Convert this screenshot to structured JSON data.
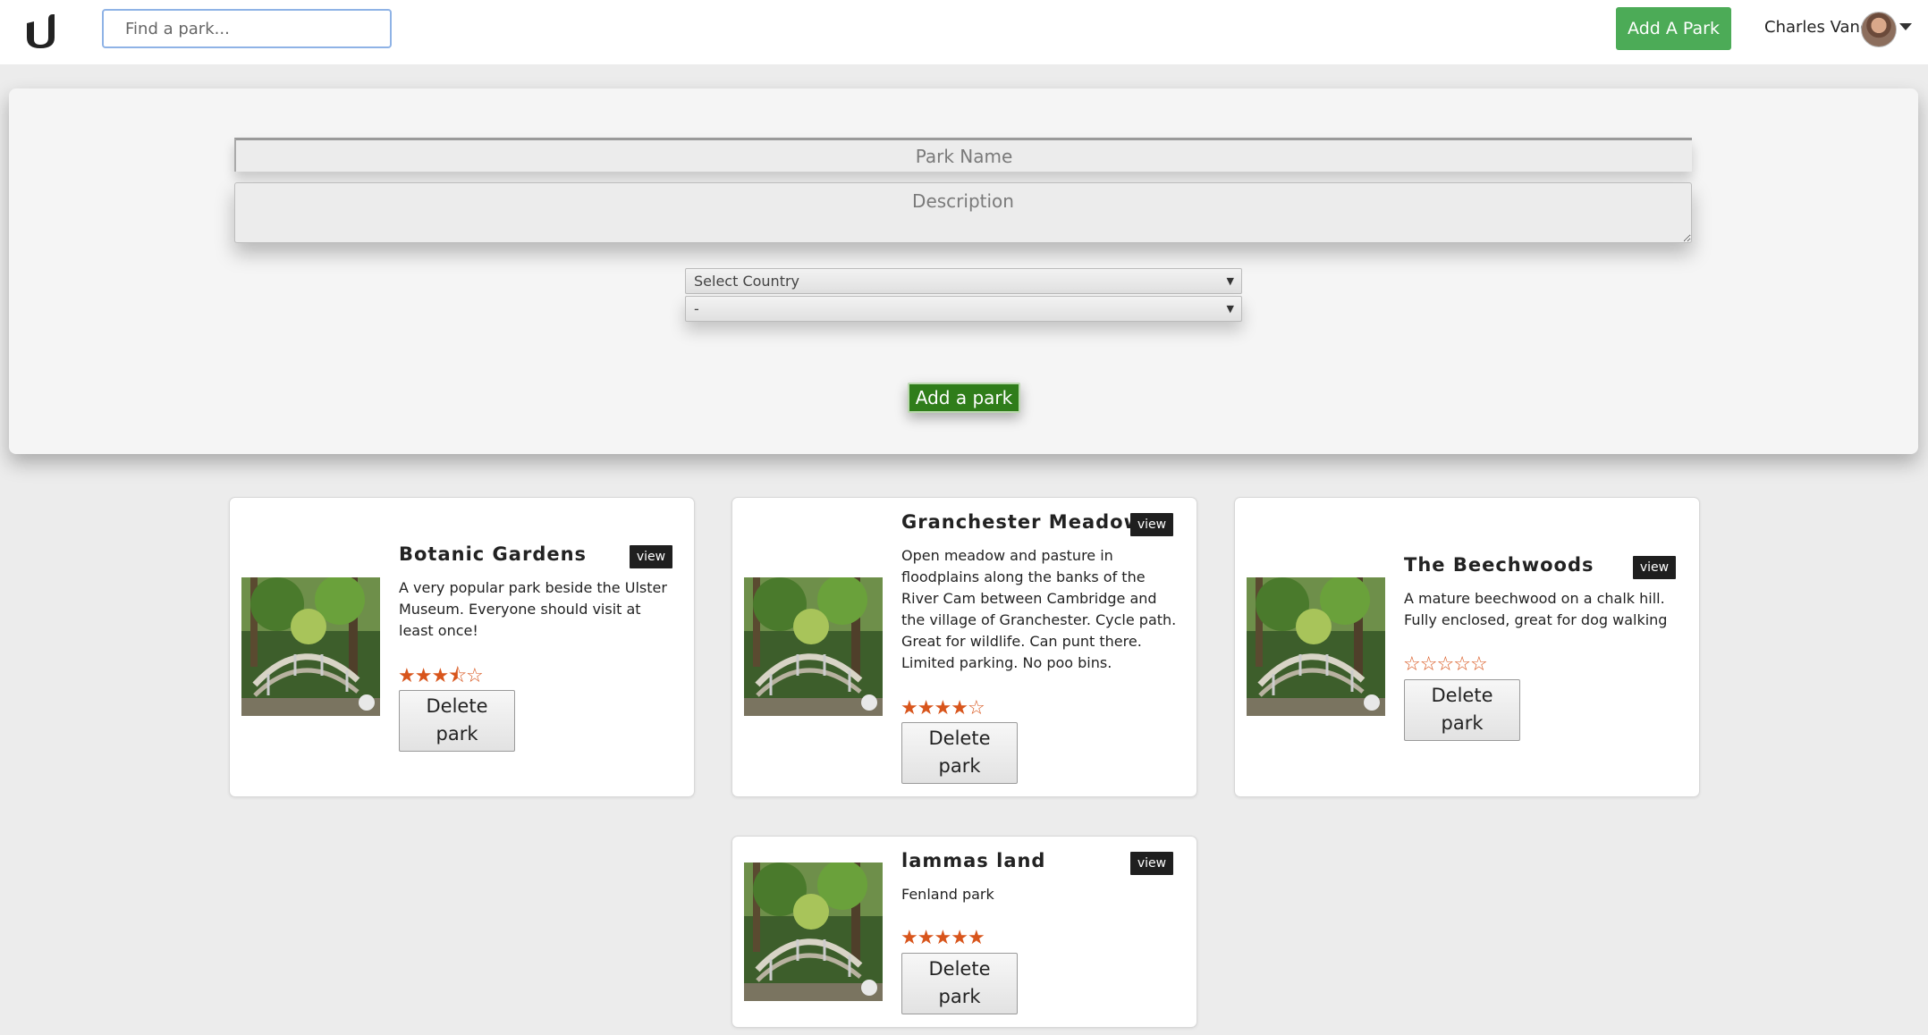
{
  "header": {
    "search_placeholder": "Find a park...",
    "add_park_label": "Add A Park",
    "user_name": "Charles Vane"
  },
  "form": {
    "name_placeholder": "Park Name",
    "description_placeholder": "Description",
    "country_select": "Select Country",
    "region_select": "-",
    "submit_label": "Add a park"
  },
  "parks": [
    {
      "name": "Botanic Gardens",
      "view_label": "view",
      "description": "A very popular park beside the Ulster Museum. Everyone should visit at least once!",
      "rating": 3.5,
      "delete_line1": "Delete",
      "delete_line2": "park"
    },
    {
      "name": "Granchester Meadows",
      "view_label": "view",
      "description": "Open meadow and pasture in floodplains along the banks of the River Cam between Cambridge and the village of Granchester. Cycle path. Great for wildlife. Can punt there. Limited parking. No poo bins.",
      "rating": 4,
      "delete_line1": "Delete",
      "delete_line2": "park"
    },
    {
      "name": "The Beechwoods",
      "view_label": "view",
      "description": "A mature beechwood on a chalk hill. Fully enclosed, great for dog walking",
      "rating": 0,
      "delete_line1": "Delete",
      "delete_line2": "park"
    },
    {
      "name": "lammas land",
      "view_label": "view",
      "description": "Fenland park",
      "rating": 5,
      "delete_line1": "Delete",
      "delete_line2": "park"
    }
  ],
  "colors": {
    "accent_green": "#4cab57",
    "submit_green": "#2f7d1a",
    "star_orange": "#d8551c"
  }
}
